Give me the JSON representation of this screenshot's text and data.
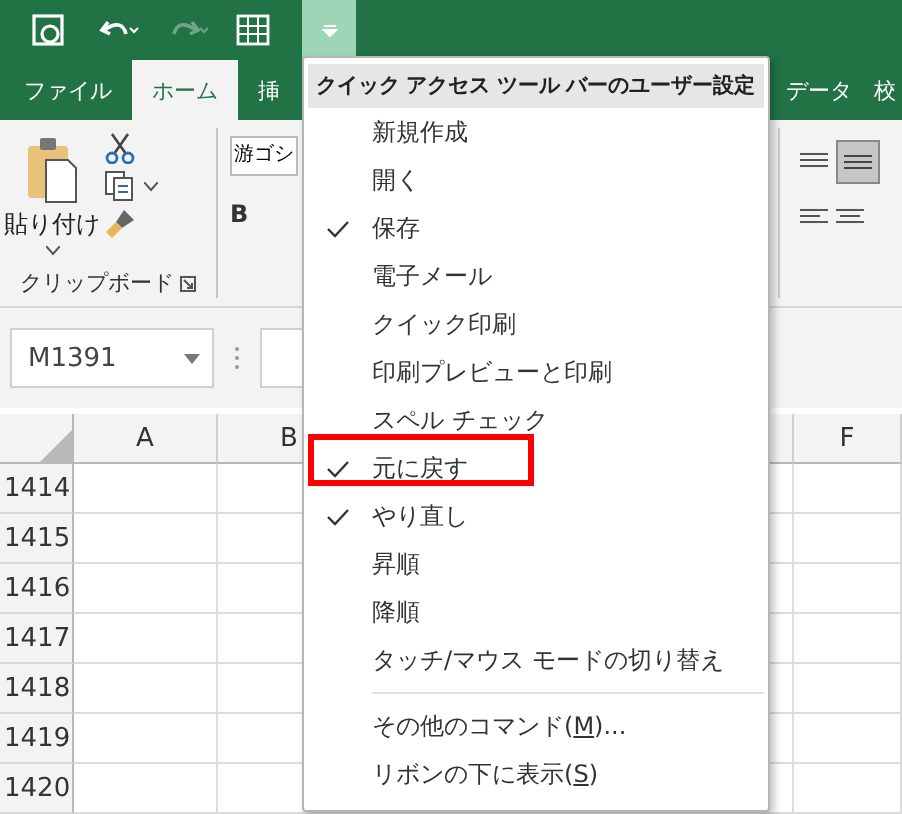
{
  "quick_access": {
    "buttons": [
      {
        "kind": "autosave",
        "disabled": false
      },
      {
        "kind": "undo",
        "disabled": false
      },
      {
        "kind": "redo",
        "disabled": true
      },
      {
        "kind": "form",
        "disabled": false
      },
      {
        "kind": "customize",
        "pressed": true
      }
    ]
  },
  "tabs": [
    {
      "label": "ファイル",
      "selected": false
    },
    {
      "label": "ホーム",
      "selected": true
    },
    {
      "label": "挿",
      "selected": false
    },
    {
      "label": "データ",
      "selected": false
    },
    {
      "label": "校",
      "selected": false
    }
  ],
  "ribbon": {
    "paste_label": "貼り付け",
    "group_label": "クリップボード",
    "font_name": "游ゴシ",
    "bold_button": "B"
  },
  "name_box": "M1391",
  "columns": [
    {
      "label": "A"
    },
    {
      "label": "B"
    },
    {
      "label": "F"
    }
  ],
  "rows": [
    {
      "header": "1414"
    },
    {
      "header": "1415"
    },
    {
      "header": "1416"
    },
    {
      "header": "1417"
    },
    {
      "header": "1418"
    },
    {
      "header": "1419"
    },
    {
      "header": "1420"
    }
  ],
  "menu": {
    "title": "クイック アクセス ツール バーのユーザー設定",
    "items": [
      {
        "kind": "item",
        "label": "新規作成",
        "checked": false
      },
      {
        "kind": "item",
        "label": "開く",
        "checked": false
      },
      {
        "kind": "item",
        "label": "保存",
        "checked": true
      },
      {
        "kind": "item",
        "label": "電子メール",
        "checked": false
      },
      {
        "kind": "item",
        "label": "クイック印刷",
        "checked": false
      },
      {
        "kind": "item",
        "label": "印刷プレビューと印刷",
        "checked": false
      },
      {
        "kind": "item",
        "label": "スペル チェック",
        "checked": false
      },
      {
        "kind": "item",
        "label": "元に戻す",
        "checked": true,
        "highlighted": true
      },
      {
        "kind": "item",
        "label": "やり直し",
        "checked": true
      },
      {
        "kind": "item",
        "label": "昇順",
        "checked": false
      },
      {
        "kind": "item",
        "label": "降順",
        "checked": false
      },
      {
        "kind": "item",
        "label": "タッチ/マウス モードの切り替え",
        "checked": false
      },
      {
        "kind": "separator"
      },
      {
        "kind": "item",
        "label": "その他のコマンド(",
        "accelerator": "M",
        "suffix": ")...",
        "checked": false
      },
      {
        "kind": "item",
        "label": "リボンの下に表示(",
        "accelerator": "S",
        "suffix": ")",
        "checked": false
      }
    ]
  }
}
